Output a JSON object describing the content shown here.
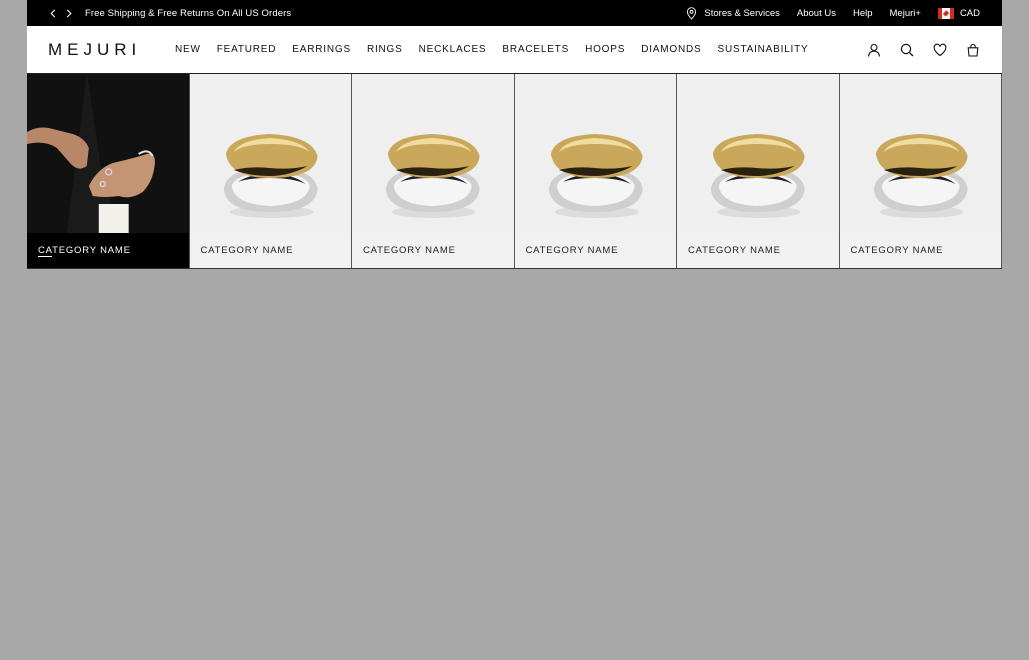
{
  "topbar": {
    "promo": "Free Shipping & Free Returns On All US Orders",
    "links": [
      "Stores & Services",
      "About Us",
      "Help",
      "Mejuri+"
    ],
    "currency": "CAD"
  },
  "nav": {
    "logo": "MEJURI",
    "menu": [
      "NEW",
      "FEATURED",
      "EARRINGS",
      "RINGS",
      "NECKLACES",
      "BRACELETS",
      "HOOPS",
      "DIAMONDS",
      "SUSTAINABILITY"
    ]
  },
  "categories": [
    {
      "label_a": "CA",
      "label_b": "TEGORY NAME"
    },
    {
      "label": "CATEGORY NAME"
    },
    {
      "label": "CATEGORY NAME"
    },
    {
      "label": "CATEGORY NAME"
    },
    {
      "label": "CATEGORY NAME"
    },
    {
      "label": "CATEGORY NAME"
    }
  ],
  "colors": {
    "page_bg": "#a8a8a8",
    "topbar_bg": "#000000",
    "gold": "#c9a85c",
    "silver": "#d9d9d9"
  }
}
